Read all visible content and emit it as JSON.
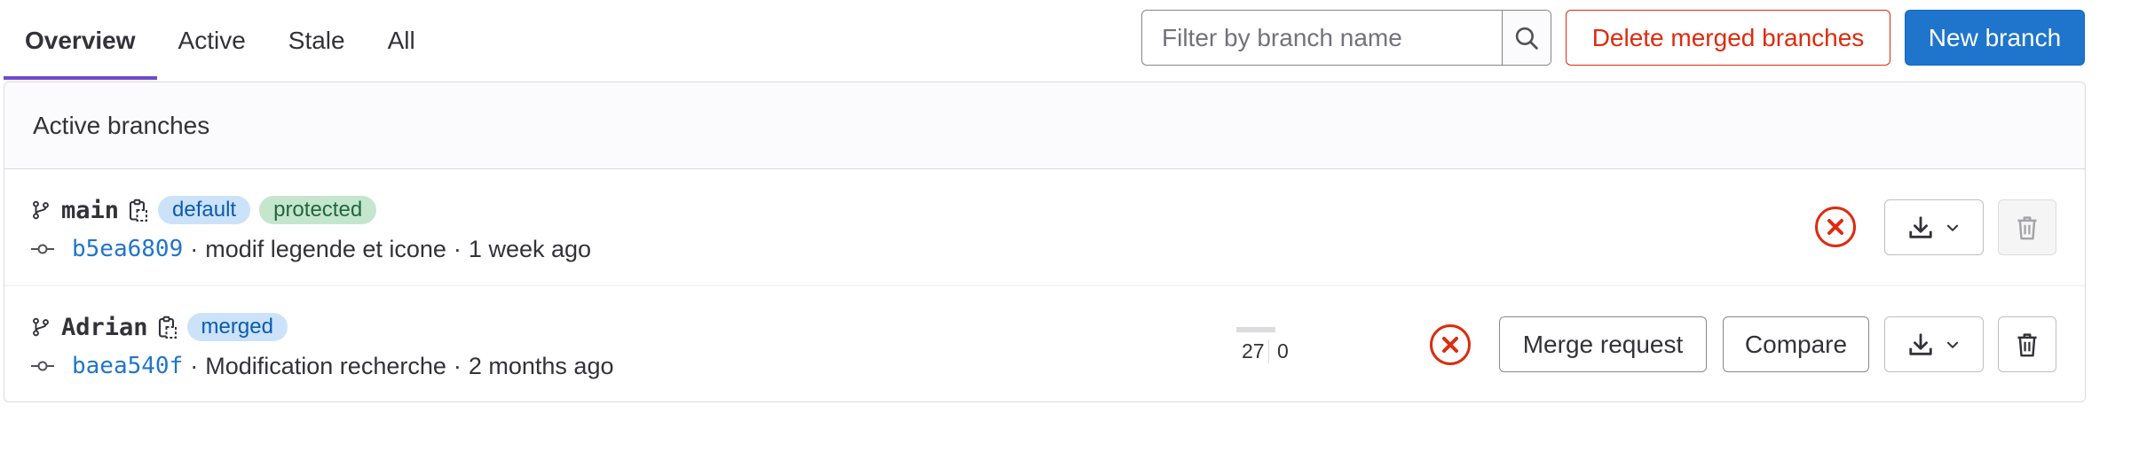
{
  "tabs": [
    {
      "label": "Overview",
      "active": true
    },
    {
      "label": "Active",
      "active": false
    },
    {
      "label": "Stale",
      "active": false
    },
    {
      "label": "All",
      "active": false
    }
  ],
  "search": {
    "placeholder": "Filter by branch name",
    "value": "",
    "icon": "search-icon"
  },
  "actions": {
    "delete_merged_label": "Delete merged branches",
    "new_branch_label": "New branch"
  },
  "panel": {
    "title": "Active branches"
  },
  "branches": [
    {
      "name": "main",
      "badges": [
        "default",
        "protected"
      ],
      "commit_sha": "b5ea6809",
      "commit_message": "modif legende et icone",
      "separator": "·",
      "commit_time": "1 week ago",
      "pipeline_status": "failed",
      "delete_disabled": true
    },
    {
      "name": "Adrian",
      "badges": [
        "merged"
      ],
      "commit_sha": "baea540f",
      "commit_message": "Modification recherche",
      "separator": "·",
      "commit_time": "2 months ago",
      "behind": "27",
      "ahead": "0",
      "pipeline_status": "failed",
      "merge_request_label": "Merge request",
      "compare_label": "Compare",
      "delete_disabled": false
    }
  ],
  "colors": {
    "accent": "#6e49cb",
    "primary": "#1f75cb",
    "danger": "#dd2b0e",
    "badge_info_bg": "#cbe2f9",
    "badge_success_bg": "#c3e6cd"
  }
}
